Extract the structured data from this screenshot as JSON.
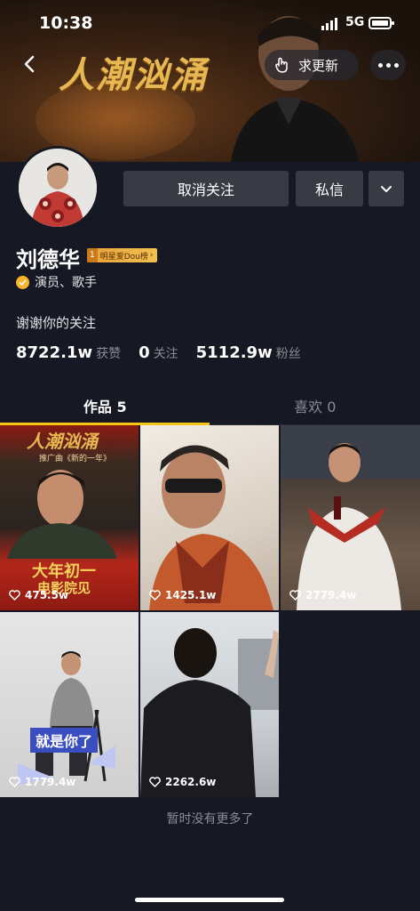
{
  "status_bar": {
    "time": "10:38",
    "network": "5G"
  },
  "header": {
    "banner_title": "人潮汹涌",
    "request_update_label": "求更新"
  },
  "profile": {
    "name": "刘德华",
    "rank_badge": {
      "number": "1",
      "text": "明星爱Dou榜"
    },
    "verification": "演员、歌手",
    "bio": "谢谢你的关注",
    "unfollow_label": "取消关注",
    "message_label": "私信",
    "stats": [
      {
        "value": "8722.1w",
        "label": "获赞"
      },
      {
        "value": "0",
        "label": "关注"
      },
      {
        "value": "5112.9w",
        "label": "粉丝"
      }
    ]
  },
  "tabs": [
    {
      "label": "作品 5",
      "active": true
    },
    {
      "label": "喜欢 0",
      "active": false
    }
  ],
  "videos": [
    {
      "likes": "475.5w",
      "overlay_lines": [
        "人潮汹涌",
        "推广曲《新的一年》",
        "大年初一",
        "电影院见"
      ]
    },
    {
      "likes": "1425.1w"
    },
    {
      "likes": "2779.4w"
    },
    {
      "likes": "1779.4w",
      "overlay_text": "就是你了"
    },
    {
      "likes": "2262.6w"
    }
  ],
  "footer_text": "暂时没有更多了",
  "colors": {
    "background": "#161823",
    "button_bg": "#393b44",
    "tab_indicator": "#f5c517",
    "muted_text": "#8b8c93",
    "badge_gold": "#f1c04f"
  }
}
